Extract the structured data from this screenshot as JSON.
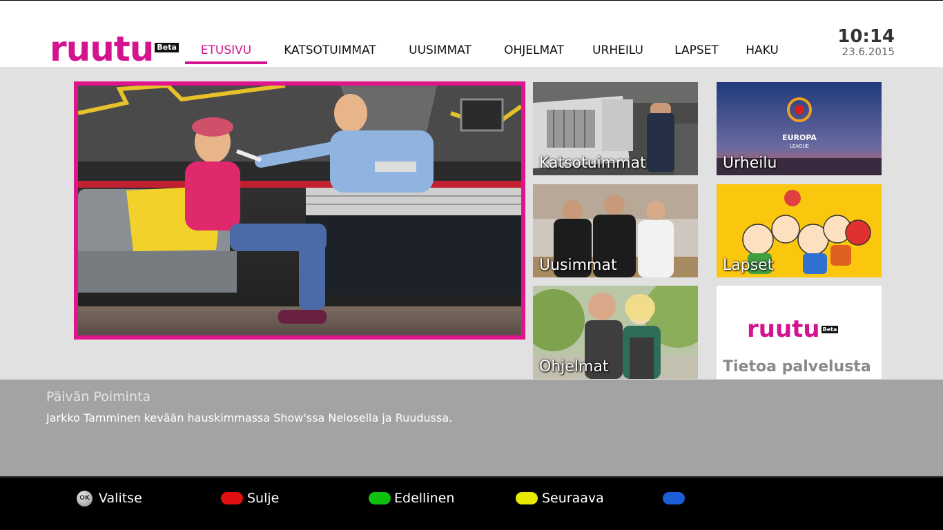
{
  "header": {
    "logo_text": "ruutu",
    "logo_badge": "Beta",
    "nav": [
      {
        "label": "ETUSIVU",
        "active": true
      },
      {
        "label": "KATSOTUIMMAT",
        "active": false
      },
      {
        "label": "UUSIMMAT",
        "active": false
      },
      {
        "label": "OHJELMAT",
        "active": false
      },
      {
        "label": "URHEILU",
        "active": false
      },
      {
        "label": "LAPSET",
        "active": false
      },
      {
        "label": "HAKU",
        "active": false
      }
    ],
    "time": "10:14",
    "date": "23.6.2015"
  },
  "tiles": {
    "katsotuimmat": "Katsotuimmat",
    "urheilu": "Urheilu",
    "uusimmat": "Uusimmat",
    "lapset": "Lapset",
    "ohjelmat": "Ohjelmat",
    "tietoa": "Tietoa palvelusta",
    "tietoa_logo": "ruutu",
    "tietoa_badge": "Beta",
    "europa_text": "EUROPA",
    "league_text": "LEAGUE"
  },
  "info": {
    "title": "Päivän Poiminta",
    "description": "Jarkko Tamminen kevään hauskimmassa Show'ssa Nelosella ja Ruudussa."
  },
  "buttons": {
    "ok_key": "OK",
    "ok_label": "Valitse",
    "red_label": "Sulje",
    "green_label": "Edellinen",
    "yellow_label": "Seuraava",
    "blue_label": ""
  },
  "colors": {
    "brand": "#d4148f",
    "red": "#e01010",
    "green": "#10c010",
    "yellow": "#e8e800",
    "blue": "#1a5fd8"
  }
}
